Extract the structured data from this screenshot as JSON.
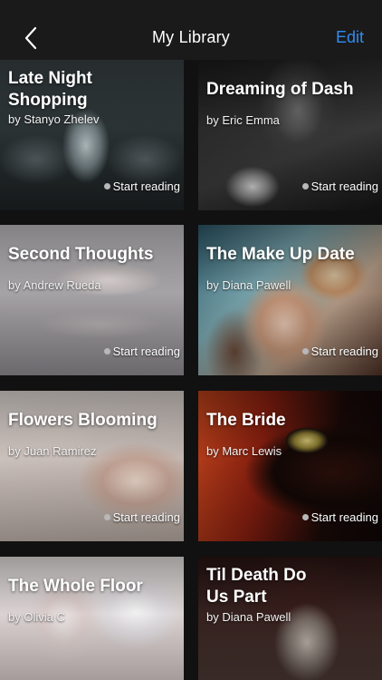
{
  "navbar": {
    "title": "My Library",
    "edit_label": "Edit",
    "back_icon": "chevron-left-icon",
    "accent_color": "#2f8cf0"
  },
  "books": [
    {
      "title": "Late Night Shopping",
      "author": "by Stanyo Zhelev",
      "action": "Start reading"
    },
    {
      "title": "Dreaming of Dash",
      "author": "by Eric Emma",
      "action": "Start reading"
    },
    {
      "title": "Second Thoughts",
      "author": "by Andrew Rueda",
      "action": "Start reading"
    },
    {
      "title": "The Make Up Date",
      "author": "by Diana Pawell",
      "action": "Start reading"
    },
    {
      "title": "Flowers Blooming",
      "author": "by Juan Ramirez",
      "action": "Start reading"
    },
    {
      "title": "The Bride",
      "author": "by Marc Lewis",
      "action": "Start reading"
    },
    {
      "title": "The Whole Floor",
      "author": "by Olivia C",
      "action": ""
    },
    {
      "title": "Til Death Do Us Part",
      "author": "by Diana Pawell",
      "action": ""
    }
  ]
}
